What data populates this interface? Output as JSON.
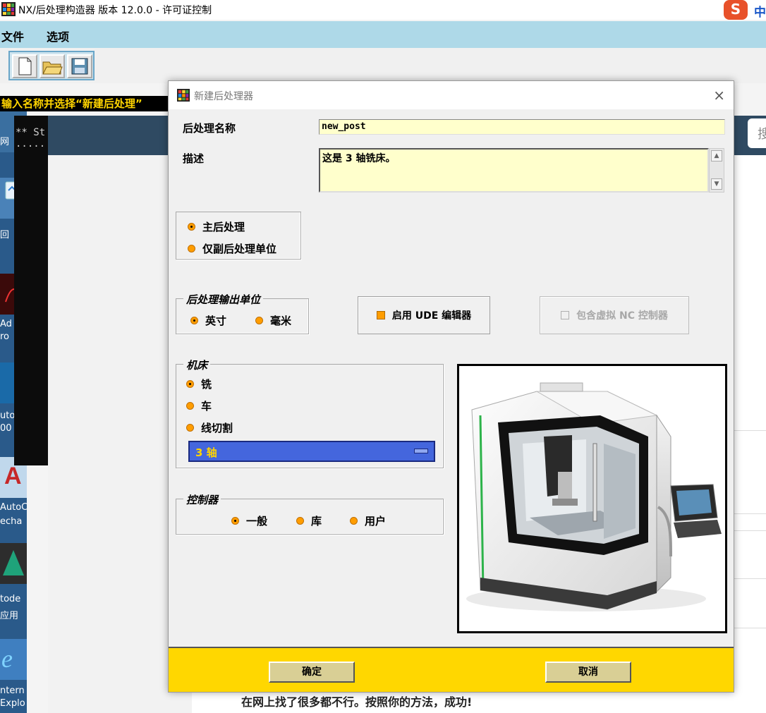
{
  "app": {
    "title": "NX/后处理构造器 版本 12.0.0 - 许可证控制",
    "ime_badge": "S",
    "ime_mode": "中",
    "menu": [
      "文件",
      "选项"
    ],
    "status": "输入名称并选择“新建后处理”"
  },
  "background": {
    "console_text": "** St\n.....",
    "search_glyph": "搜",
    "comment": "在网上找了很多都不行。按照你的方法，成功!",
    "desktop_labels": [
      "网",
      "回",
      "Ad",
      "ro",
      "uto",
      "00",
      "AutoC",
      "echa",
      "tode",
      "应用",
      "ntern",
      "Explo"
    ]
  },
  "dialog": {
    "title": "新建后处理器",
    "close_glyph": "×",
    "name_label": "后处理名称",
    "name_value": "new_post",
    "desc_label": "描述",
    "desc_value": "这是 3 轴铣床。",
    "post_type": {
      "options": [
        "主后处理",
        "仅副后处理单位"
      ],
      "selected": 0
    },
    "units": {
      "legend": "后处理输出单位",
      "options": [
        "英寸",
        "毫米"
      ],
      "selected": 0
    },
    "ude_label": "启用 UDE 编辑器",
    "ude_checked": true,
    "vnc_label": "包含虚拟 NC 控制器",
    "vnc_checked": false,
    "machine": {
      "legend": "机床",
      "options": [
        "铣",
        "车",
        "线切割"
      ],
      "selected": 0,
      "axis_value": "3 轴"
    },
    "controller": {
      "legend": "控制器",
      "options": [
        "一般",
        "库",
        "用户"
      ],
      "selected": 0
    },
    "ok_label": "确定",
    "cancel_label": "取消"
  },
  "colors": {
    "menubar": "#aed9e8",
    "input_bg": "#ffffcc",
    "radio": "#ff9d00",
    "select_bg": "#4466dd",
    "select_text": "#ffd400",
    "footer": "#ffd700"
  }
}
